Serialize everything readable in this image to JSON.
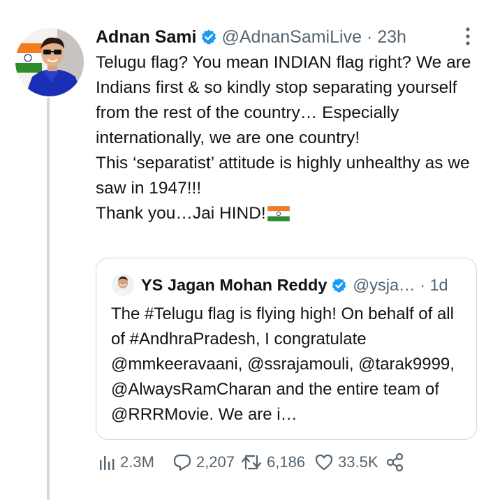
{
  "tweet": {
    "author": {
      "name": "Adnan Sami",
      "handle": "@AdnanSamiLive",
      "separator": "·",
      "time": "23h",
      "verified": true
    },
    "text_lines": [
      "Telugu flag? You mean INDIAN flag right? We are Indians first & so kindly stop separating yourself from the rest of the country… Especially internationally, we are one country!",
      "This ‘separatist’ attitude is highly unhealthy as we saw in 1947!!!",
      "Thank you…Jai HIND!"
    ],
    "trailing_emoji": "india-flag-icon"
  },
  "quoted_tweet": {
    "author": {
      "name": "YS Jagan Mohan Reddy",
      "handle": "@ysja…",
      "separator": "·",
      "time": "1d",
      "verified": true
    },
    "text": "The #Telugu flag is flying high! On behalf of all of #AndhraPradesh, I congratulate @mmkeeravaani, @ssrajamouli, @tarak9999, @AlwaysRamCharan and the entire team of @RRRMovie. We are i…"
  },
  "actions": {
    "views": "2.3M",
    "replies": "2,207",
    "retweets": "6,186",
    "likes": "33.5K"
  },
  "colors": {
    "text": "#0f1419",
    "secondary": "#536471",
    "verified": "#1d9bf0",
    "border": "#cfd9de"
  }
}
